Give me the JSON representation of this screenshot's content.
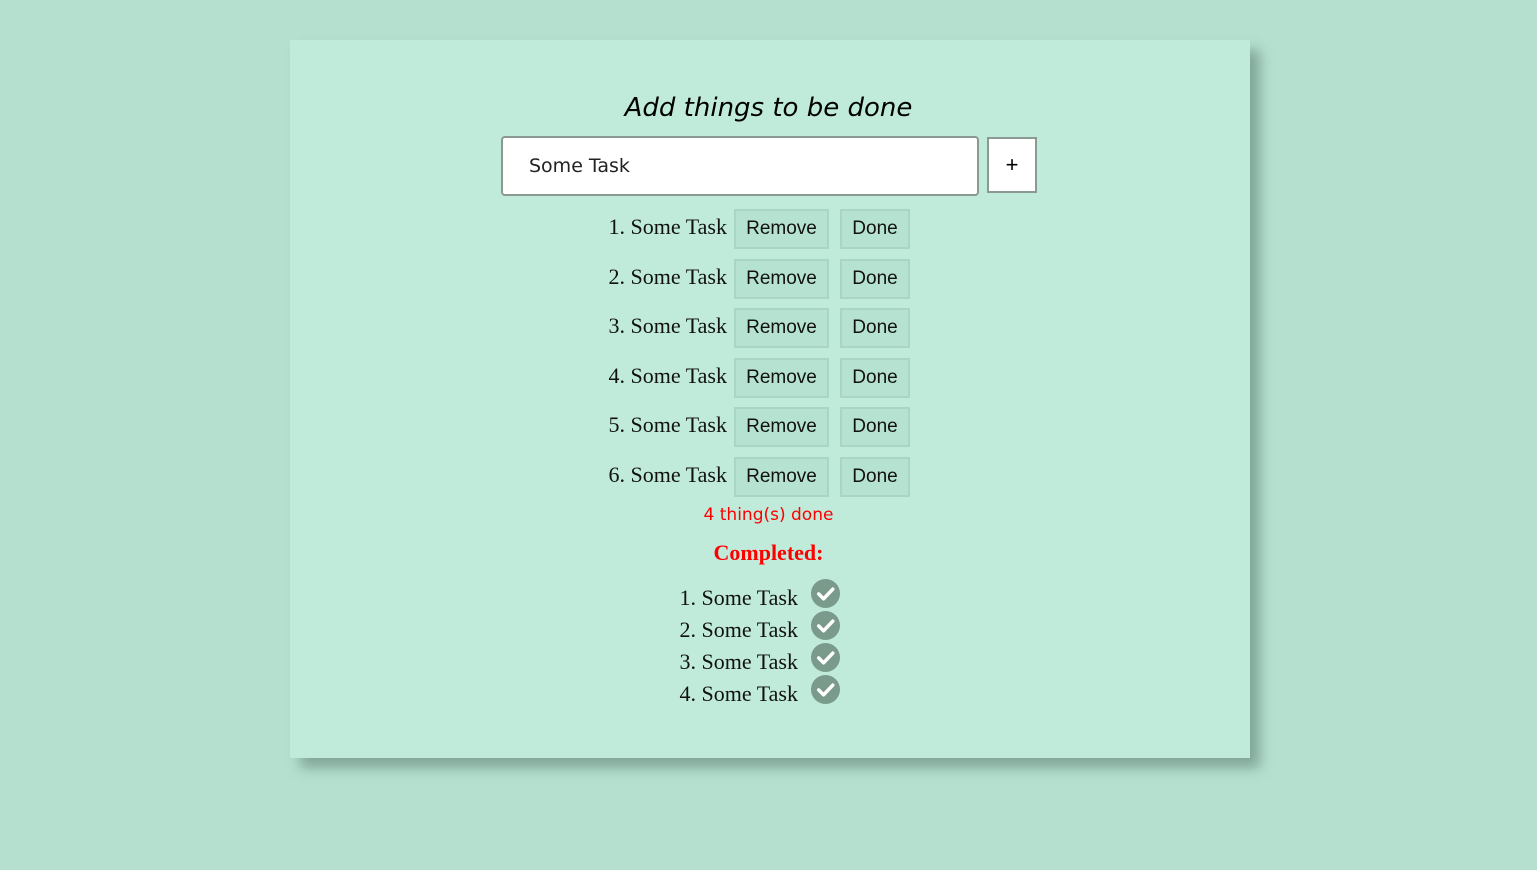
{
  "header": {
    "title": "Add things to be done"
  },
  "input": {
    "value": "Some Task",
    "add_label": "+"
  },
  "todos": [
    {
      "label": "1. Some Task",
      "remove": "Remove",
      "done": "Done"
    },
    {
      "label": "2. Some Task",
      "remove": "Remove",
      "done": "Done"
    },
    {
      "label": "3. Some Task",
      "remove": "Remove",
      "done": "Done"
    },
    {
      "label": "4. Some Task",
      "remove": "Remove",
      "done": "Done"
    },
    {
      "label": "5. Some Task",
      "remove": "Remove",
      "done": "Done"
    },
    {
      "label": "6. Some Task",
      "remove": "Remove",
      "done": "Done"
    }
  ],
  "summary": {
    "done_count": "4 thing(s) done"
  },
  "completed": {
    "heading": "Completed:",
    "items": [
      {
        "label": "1. Some Task",
        "icon": "check-circle-icon"
      },
      {
        "label": "2. Some Task",
        "icon": "check-circle-icon"
      },
      {
        "label": "3. Some Task",
        "icon": "check-circle-icon"
      },
      {
        "label": "4. Some Task",
        "icon": "check-circle-icon"
      }
    ]
  },
  "colors": {
    "background": "#b5e0d0",
    "card": "#c0ebdb",
    "button": "#b6e2d1",
    "alert": "#ff0000",
    "check": "#7a9a8c"
  }
}
